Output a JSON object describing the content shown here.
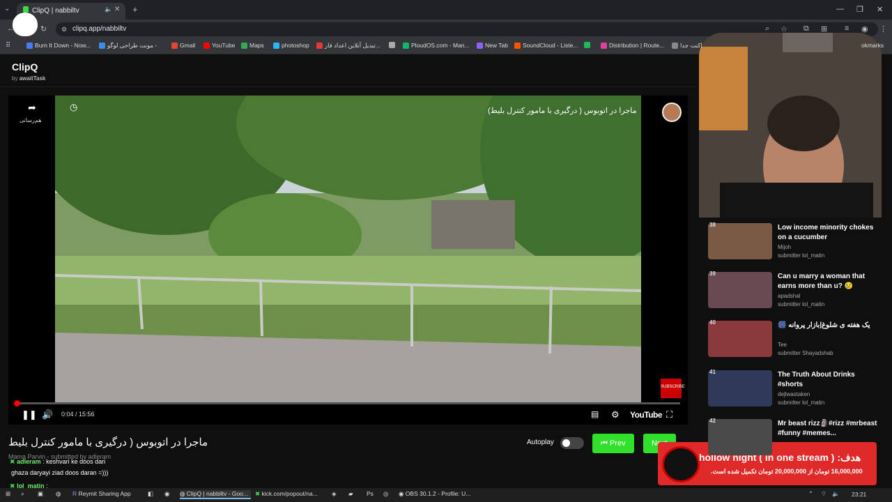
{
  "browser": {
    "tab_title": "ClipQ | nabbiltv",
    "address": "clipq.app/nabbiltv",
    "bookmarks": [
      "Burn It Down - Now...",
      "مونت طراحی لوگو -",
      "Gmail",
      "YouTube",
      "Maps",
      "photoshop",
      "تبدیل آنلاین اعداد فار...",
      "",
      "PloudOS.com - Man...",
      "New Tab",
      "SoundCloud - Liste...",
      "",
      "Distribution | Route...",
      "اکنت جدا",
      "okmarks"
    ],
    "bookmark_colors": [
      "#4a7aff",
      "#3a8ee6",
      "#ea4335",
      "#ff0000",
      "#34a853",
      "#29b6f6",
      "#e53935",
      "#aaaaaa",
      "#0db86d",
      "#8a63ff",
      "#ff5500",
      "#1db954",
      "#e040a0",
      "#888888",
      "#888888"
    ]
  },
  "app": {
    "logo": "ClipQ",
    "byline_prefix": "by",
    "byline_author": "awaitTask"
  },
  "player": {
    "video_title": "ماجرا در اتوبوس ( درگیری با مامور کنترل بلیط)",
    "share_label": "هم‌رسانی",
    "time": "0:04 / 15:56",
    "progress": 0.0042,
    "platform": "YouTube",
    "subscribe": "SUBSCRIBE"
  },
  "clip": {
    "title": "ماجرا در اتوبوس ( درگیری با مامور کنترل بلیط",
    "channel": "Mama Parvin",
    "submitted": "- submitted by adleram",
    "autoplay_label": "Autoplay",
    "prev_label": "Prev",
    "next_label": "Next"
  },
  "chat": [
    {
      "name": "adleram",
      "text": ": keshvari ke doos dari"
    },
    {
      "name": "",
      "text": "ghaza daryayi ziad doos daran =)))"
    },
    {
      "name": "lol_matin",
      "text": ":"
    }
  ],
  "queue": [
    {
      "num": "38",
      "title": "Low income minority chokes on a cucumber",
      "channel": "Mijoh",
      "submitter": "submitter lol_matin"
    },
    {
      "num": "39",
      "title": "Can u marry a woman that earns more than u? 😢",
      "channel": "apadshal",
      "submitter": "submitter lol_matin"
    },
    {
      "num": "40",
      "title": "🎆 یک هفته ی شلوغ|بازار پروانه",
      "channel": "Tee",
      "submitter": "submitter Shayadshab"
    },
    {
      "num": "41",
      "title": "The Truth About Drinks #shorts",
      "channel": "dejlwastaken",
      "submitter": "submitter lol_matin"
    },
    {
      "num": "42",
      "title": "Mr beast rizz🗿#rizz #mrbeast #funny #memes...",
      "channel": "",
      "submitter": ""
    }
  ],
  "goal": {
    "title": "هدف: ( hollow night ( in one stream",
    "subtitle": "16,000,000 تومان از 20,000,000 تومان تکمیل شده است."
  },
  "taskbar": {
    "items": [
      "Reymit Sharing App",
      "ClipQ | nabbiltv - Goo...",
      "kick.com/popout/na...",
      "OBS 30.1.2 - Profile: U..."
    ],
    "time": "23:21"
  }
}
